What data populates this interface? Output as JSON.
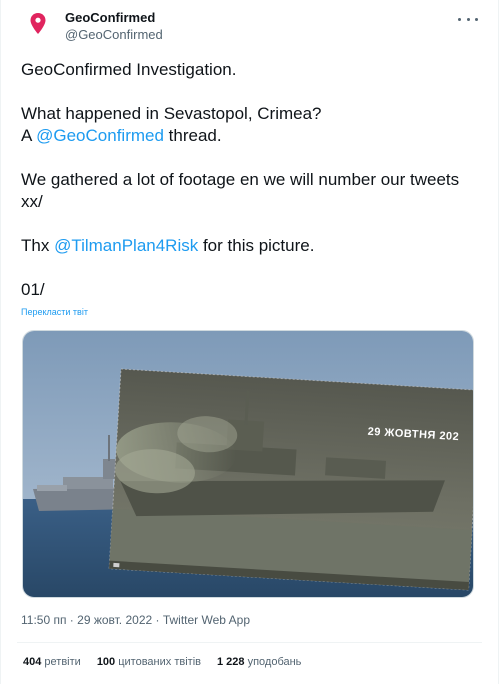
{
  "author": {
    "display_name": "GeoConfirmed",
    "handle": "@GeoConfirmed"
  },
  "tweet": {
    "line1": "GeoConfirmed Investigation.",
    "line2": "What happened in Sevastopol, Crimea?",
    "line3_prefix": "A ",
    "line3_mention": "@GeoConfirmed",
    "line3_suffix": " thread.",
    "line4": "We gathered a lot of footage en we will number our tweets xx/",
    "line5_prefix": "Thx ",
    "line5_mention": "@TilmanPlan4Risk",
    "line5_suffix": " for this picture.",
    "line6": "01/"
  },
  "translate_label": "Перекласти твіт",
  "media": {
    "overlay_date": "29 ЖОВТНЯ 202"
  },
  "timestamp": {
    "time": "11:50 пп",
    "date": "29 жовт. 2022",
    "source": "Twitter Web App",
    "sep": " · "
  },
  "stats": {
    "retweets_count": "404",
    "retweets_label": "ретвіти",
    "quotes_count": "100",
    "quotes_label": "цитованих твітів",
    "likes_count": "1 228",
    "likes_label": "уподобань"
  },
  "colors": {
    "accent": "#1d9bf0",
    "muted": "#536471",
    "pin": "#e0245e"
  },
  "icons": [
    "map-pin-icon",
    "more-icon"
  ]
}
